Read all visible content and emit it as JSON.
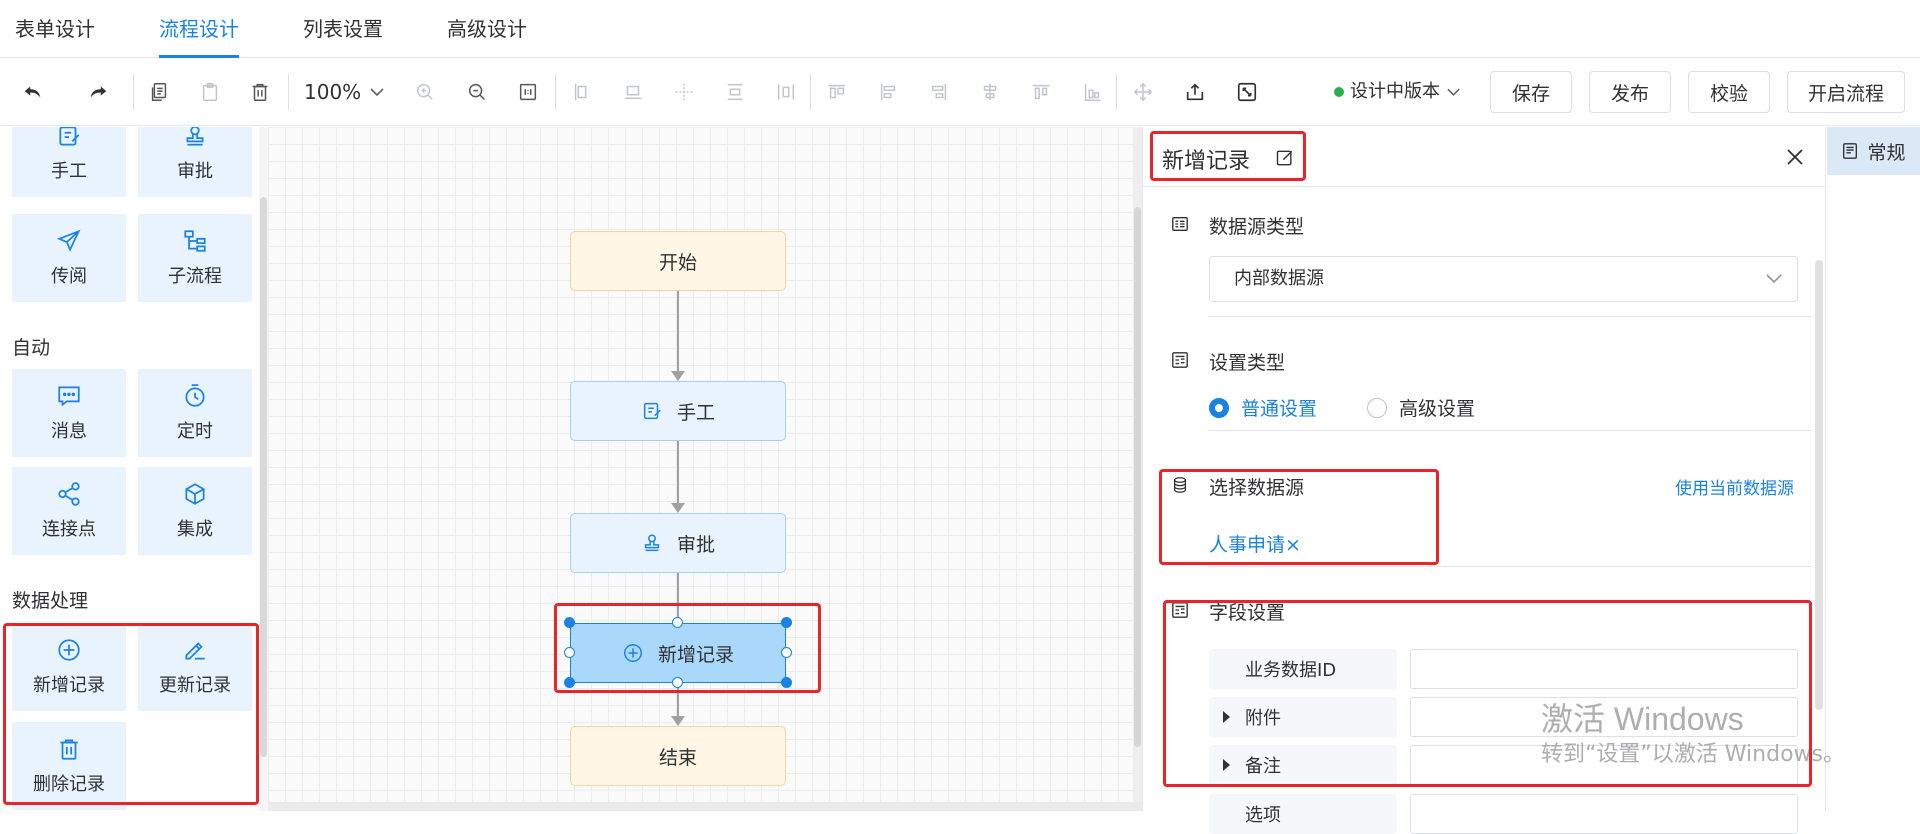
{
  "top_tabs": [
    {
      "label": "表单设计"
    },
    {
      "label": "流程设计",
      "active": true
    },
    {
      "label": "列表设置"
    },
    {
      "label": "高级设计"
    }
  ],
  "toolbar": {
    "zoom": "100%",
    "version_label": "设计中版本",
    "version_color": "#2cae4a",
    "buttons": {
      "save": "保存",
      "publish": "发布",
      "verify": "校验",
      "start_flow": "开启流程"
    }
  },
  "palette": {
    "tiles_top": [
      {
        "label": "手工",
        "icon": "manual-task-icon"
      },
      {
        "label": "审批",
        "icon": "approval-stamp-icon"
      },
      {
        "label": "传阅",
        "icon": "paper-plane-icon"
      },
      {
        "label": "子流程",
        "icon": "subprocess-icon"
      }
    ],
    "group_auto": "自动",
    "tiles_auto": [
      {
        "label": "消息",
        "icon": "message-icon"
      },
      {
        "label": "定时",
        "icon": "timer-icon"
      },
      {
        "label": "连接点",
        "icon": "share-nodes-icon"
      },
      {
        "label": "集成",
        "icon": "cube-icon"
      }
    ],
    "group_data": "数据处理",
    "tiles_data": [
      {
        "label": "新增记录",
        "icon": "add-circle-icon"
      },
      {
        "label": "更新记录",
        "icon": "edit-pen-icon"
      },
      {
        "label": "删除记录",
        "icon": "trash-icon"
      }
    ]
  },
  "flow": {
    "nodes": [
      {
        "label": "开始",
        "kind": "start"
      },
      {
        "label": "手工",
        "kind": "task"
      },
      {
        "label": "审批",
        "kind": "task"
      },
      {
        "label": "新增记录",
        "kind": "selected"
      },
      {
        "label": "结束",
        "kind": "end"
      }
    ]
  },
  "props": {
    "title": "新增记录",
    "datasource_type": {
      "label": "数据源类型",
      "value": "内部数据源"
    },
    "setting_type": {
      "label": "设置类型",
      "options": [
        "普通设置",
        "高级设置"
      ],
      "selected": "普通设置"
    },
    "select_datasource": {
      "label": "选择数据源",
      "link": "使用当前数据源",
      "tag": "人事申请×"
    },
    "field_settings": {
      "label": "字段设置",
      "fields": [
        "业务数据ID",
        "附件",
        "备注",
        "选项"
      ]
    }
  },
  "right_tab": {
    "label": "常规"
  },
  "watermark": {
    "line1": "激活 Windows",
    "line2": "转到“设置”以激活 Windows。"
  },
  "colors": {
    "accent": "#1a82e2",
    "highlight": "#e8252b",
    "tile_bg": "#e8f3fd"
  }
}
